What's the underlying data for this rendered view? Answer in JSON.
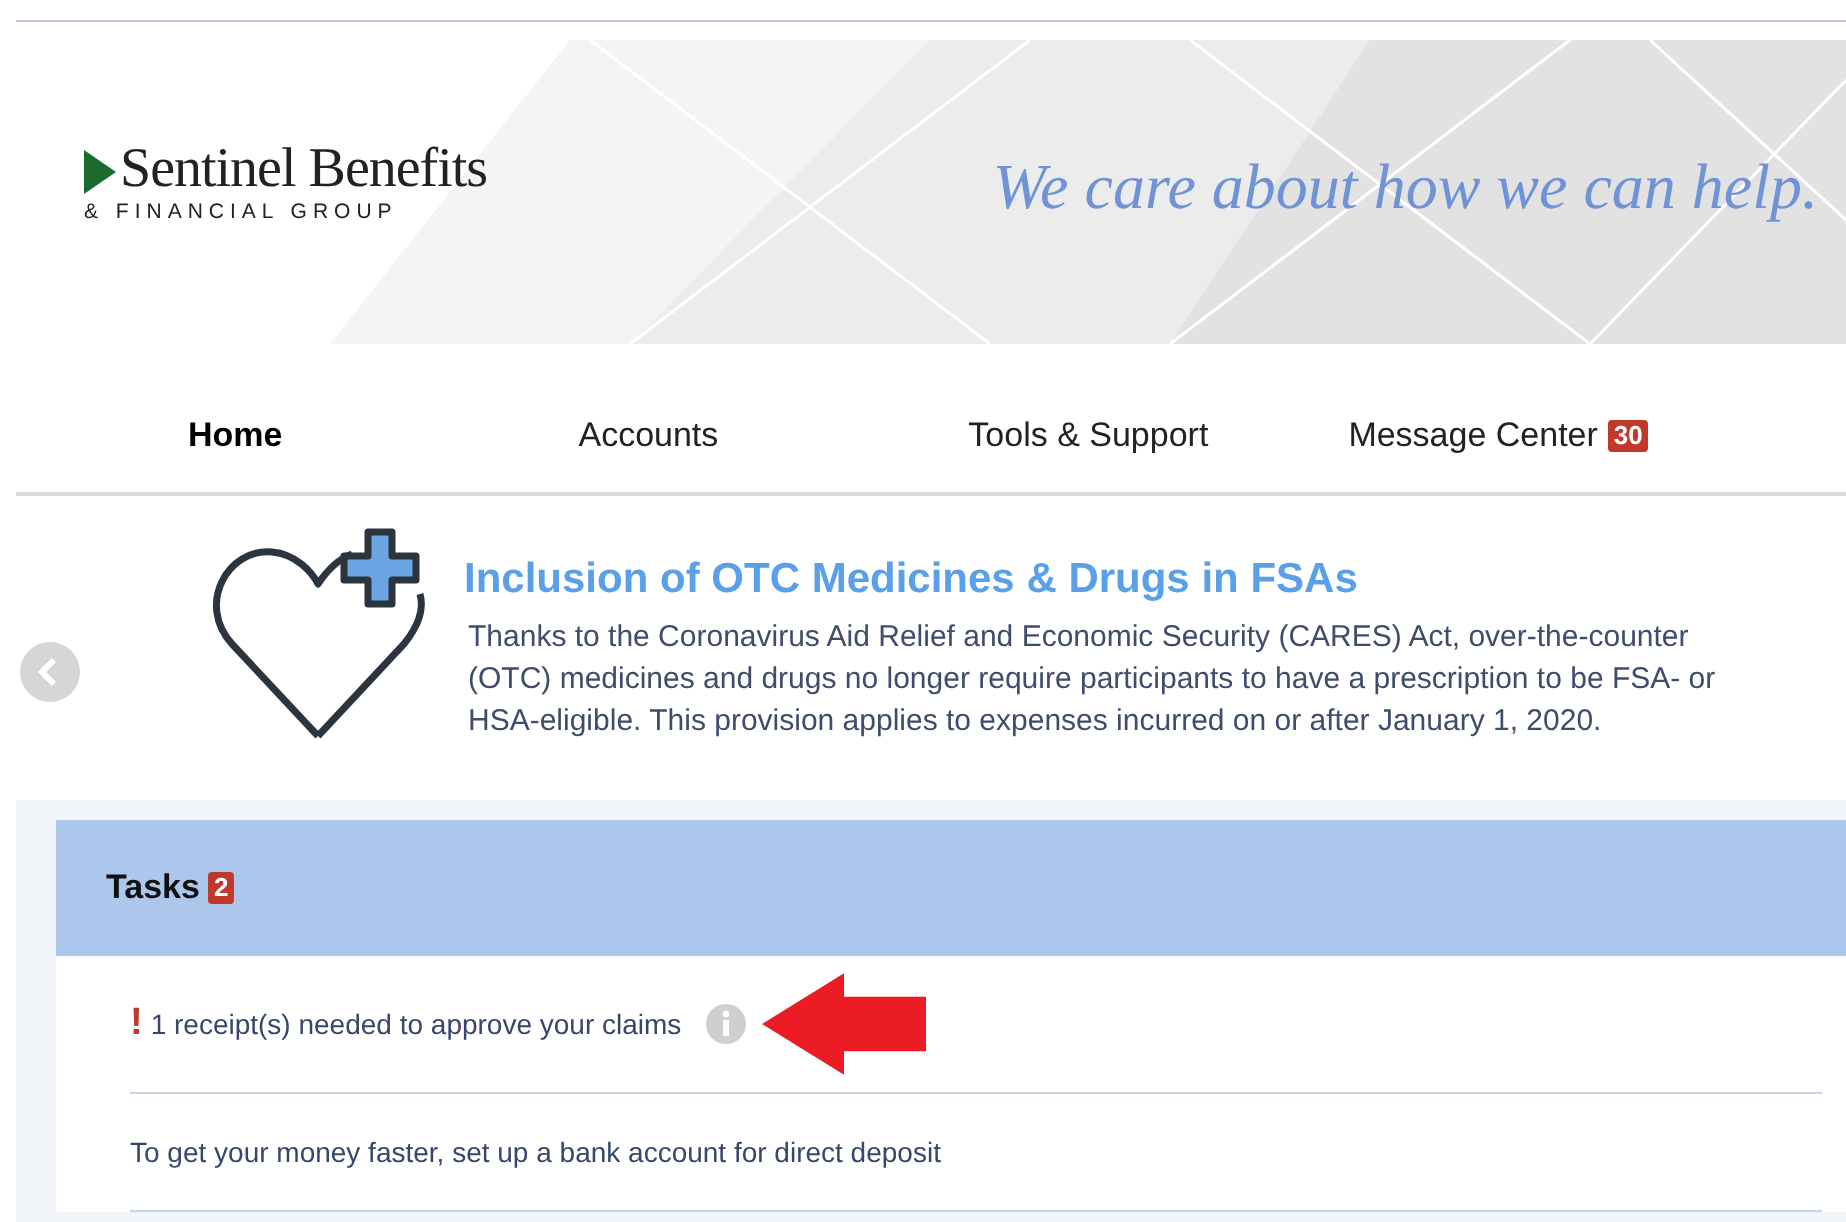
{
  "header": {
    "logo": {
      "name": "Sentinel Benefits",
      "subtitle": "& FINANCIAL GROUP"
    },
    "tagline": "We care about how we can help."
  },
  "nav": [
    {
      "label": "Home",
      "selected": true
    },
    {
      "label": "Accounts",
      "selected": false
    },
    {
      "label": "Tools & Support",
      "selected": false
    },
    {
      "label": "Message Center",
      "selected": false,
      "badge": "30"
    }
  ],
  "promo": {
    "title": "Inclusion of OTC Medicines & Drugs in FSAs",
    "text": "Thanks to the Coronavirus Aid Relief and Economic Security (CARES) Act, over-the-counter (OTC) medicines and drugs no longer require participants to have a prescription to be FSA- or HSA-eligible. This provision applies to expenses incurred on or after January 1, 2020."
  },
  "tasks": {
    "title": "Tasks",
    "badge": "2",
    "items": [
      {
        "kind": "alert",
        "marker": "!",
        "text": "1 receipt(s) needed to approve your claims"
      },
      {
        "kind": "plain",
        "text": "To get your money faster, set up a bank account for direct deposit"
      }
    ]
  }
}
